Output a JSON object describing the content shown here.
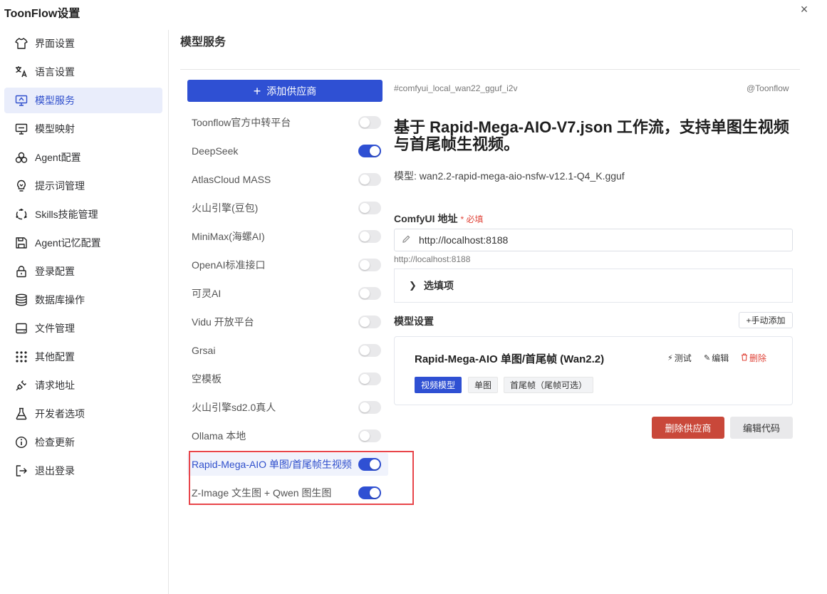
{
  "window": {
    "title": "ToonFlow设置",
    "close_glyph": "×"
  },
  "sidebar": {
    "items": [
      {
        "label": "界面设置",
        "icon": "shirt-icon"
      },
      {
        "label": "语言设置",
        "icon": "translate-icon"
      },
      {
        "label": "模型服务",
        "icon": "monitor-model-icon",
        "active": true
      },
      {
        "label": "模型映射",
        "icon": "monitor-map-icon"
      },
      {
        "label": "Agent配置",
        "icon": "agent-icon"
      },
      {
        "label": "提示词管理",
        "icon": "bulb-icon"
      },
      {
        "label": "Skills技能管理",
        "icon": "skills-icon"
      },
      {
        "label": "Agent记忆配置",
        "icon": "save-icon"
      },
      {
        "label": "登录配置",
        "icon": "lock-icon"
      },
      {
        "label": "数据库操作",
        "icon": "database-icon"
      },
      {
        "label": "文件管理",
        "icon": "drive-icon"
      },
      {
        "label": "其他配置",
        "icon": "grid-dots-icon"
      },
      {
        "label": "请求地址",
        "icon": "plug-icon"
      },
      {
        "label": "开发者选项",
        "icon": "flask-icon"
      },
      {
        "label": "检查更新",
        "icon": "info-icon"
      },
      {
        "label": "退出登录",
        "icon": "logout-icon"
      }
    ]
  },
  "main": {
    "section_title": "模型服务",
    "add_provider_label": "添加供应商",
    "providers": [
      {
        "name": "Toonflow官方中转平台",
        "enabled": false
      },
      {
        "name": "DeepSeek",
        "enabled": true
      },
      {
        "name": "AtlasCloud MASS",
        "enabled": false
      },
      {
        "name": "火山引擎(豆包)",
        "enabled": false
      },
      {
        "name": "MiniMax(海螺AI)",
        "enabled": false
      },
      {
        "name": "OpenAI标准接口",
        "enabled": false
      },
      {
        "name": "可灵AI",
        "enabled": false
      },
      {
        "name": "Vidu 开放平台",
        "enabled": false
      },
      {
        "name": "Grsai",
        "enabled": false
      },
      {
        "name": "空模板",
        "enabled": false
      },
      {
        "name": "火山引擎sd2.0真人",
        "enabled": false
      },
      {
        "name": "Ollama 本地",
        "enabled": false
      },
      {
        "name": "Rapid-Mega-AIO 单图/首尾帧生视频",
        "enabled": true,
        "active": true
      },
      {
        "name": "Z-Image 文生图 + Qwen 图生图",
        "enabled": true
      }
    ],
    "highlight_color": "#e8454a"
  },
  "detail": {
    "tag": "#comfyui_local_wan22_gguf_i2v",
    "author": "@Toonflow",
    "headline": "基于 Rapid-Mega-AIO-V7.json 工作流，支持单图生视频与首尾帧生视频。",
    "model_line": "模型: wan2.2-rapid-mega-aio-nsfw-v12.1-Q4_K.gguf",
    "comfy_label": "ComfyUI 地址",
    "required_label": "* 必填",
    "comfy_value": "http://localhost:8188",
    "comfy_hint": "http://localhost:8188",
    "optional_label": "选填项",
    "model_settings_label": "模型设置",
    "manual_add_label": "+手动添加",
    "card": {
      "title": "Rapid-Mega-AIO 单图/首尾帧 (Wan2.2)",
      "test_label": "测试",
      "edit_label": "编辑",
      "delete_label": "删除",
      "chips": [
        "视频模型",
        "单图",
        "首尾帧（尾帧可选）"
      ]
    },
    "delete_provider_label": "删除供应商",
    "edit_code_label": "编辑代码"
  },
  "colors": {
    "accent": "#2f50d3",
    "danger": "#c9483a",
    "required": "#e0453a"
  }
}
